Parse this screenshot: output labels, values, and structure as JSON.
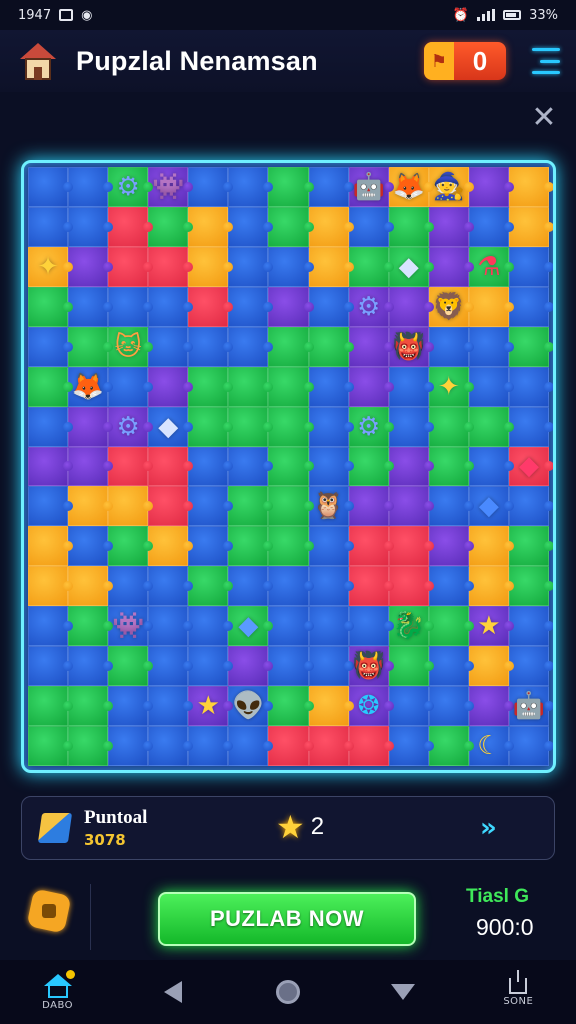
{
  "status": {
    "time": "1947",
    "battery": "33%"
  },
  "header": {
    "title": "Pupzlal Nenamsan",
    "coins": "0",
    "coin_icon": "flag-coin-icon",
    "menu_icon": "menu-icon"
  },
  "close_label": "✕",
  "board": {
    "rows": 15,
    "cols": 13,
    "colors": {
      "B": "#3a7bf0",
      "G": "#38d968",
      "P": "#8a4ee8",
      "O": "#ffc23a",
      "R": "#ff5066",
      "T": "#2cc0d0"
    },
    "grid": [
      "BBGPBBGBPOOPO",
      "BBRGOBGOBGPBO",
      "OPRROBBOGGPGB",
      "GBBBRBPBPPOOB",
      "BGGBBBGGPPBBG",
      "GBBPGGGBPBGBB",
      "BPPBGGGBGBGGB",
      "PPRRBBGBGPGBR",
      "BOORBGGBPPBBB",
      "OBGOBGGBRRPOG",
      "OOBBGBBBRRBOG",
      "BGBBBGBBBGGPB",
      "BBGBBPBBPGBOB",
      "GGBBPBGOPBBPB",
      "GGBBBBRRRBGBB"
    ],
    "pieces": [
      {
        "name": "gear-piece-icon",
        "glyph": "⚙",
        "row": 0,
        "col": 2,
        "color": "#7aa0ff"
      },
      {
        "name": "green-creature-icon",
        "glyph": "👾",
        "row": 0,
        "col": 3,
        "color": "#5df070"
      },
      {
        "name": "robot-creature-icon",
        "glyph": "🤖",
        "row": 0,
        "col": 8,
        "color": "#4fb0ff"
      },
      {
        "name": "fox-creature-icon",
        "glyph": "🦊",
        "row": 0,
        "col": 9,
        "color": "#ff9a3a"
      },
      {
        "name": "wizard-creature-icon",
        "glyph": "🧙",
        "row": 0,
        "col": 10,
        "color": "#b070ff"
      },
      {
        "name": "gold-star-icon",
        "glyph": "✦",
        "row": 2,
        "col": 0,
        "color": "#ffd23a"
      },
      {
        "name": "crystal-piece-icon",
        "glyph": "◆",
        "row": 2,
        "col": 9,
        "color": "#d8e4ff"
      },
      {
        "name": "potion-piece-icon",
        "glyph": "⚗",
        "row": 2,
        "col": 11,
        "color": "#ff3a5a"
      },
      {
        "name": "blue-gear-icon",
        "glyph": "⚙",
        "row": 3,
        "col": 8,
        "color": "#7aa0ff"
      },
      {
        "name": "lion-creature-icon",
        "glyph": "🦁",
        "row": 3,
        "col": 10,
        "color": "#ffb05a"
      },
      {
        "name": "cat-creature-icon",
        "glyph": "🐱",
        "row": 4,
        "col": 2,
        "color": "#ffa040"
      },
      {
        "name": "pink-monster-icon",
        "glyph": "👹",
        "row": 4,
        "col": 9,
        "color": "#ff4a9a"
      },
      {
        "name": "fox-kit-icon",
        "glyph": "🦊",
        "row": 5,
        "col": 1,
        "color": "#ff9a3a"
      },
      {
        "name": "gold-star-icon",
        "glyph": "✦",
        "row": 5,
        "col": 10,
        "color": "#ffd23a"
      },
      {
        "name": "blue-gear-icon",
        "glyph": "⚙",
        "row": 6,
        "col": 2,
        "color": "#7aa0ff"
      },
      {
        "name": "crystal-piece-icon",
        "glyph": "◆",
        "row": 6,
        "col": 3,
        "color": "#d8e4ff"
      },
      {
        "name": "blue-gear-icon",
        "glyph": "⚙",
        "row": 6,
        "col": 8,
        "color": "#7aa0ff"
      },
      {
        "name": "ruby-gem-icon",
        "glyph": "◆",
        "row": 7,
        "col": 12,
        "color": "#ff3a6a"
      },
      {
        "name": "owl-creature-icon",
        "glyph": "🦉",
        "row": 8,
        "col": 7,
        "color": "#ff9a3a"
      },
      {
        "name": "blue-fish-icon",
        "glyph": "◆",
        "row": 8,
        "col": 11,
        "color": "#4a8aff"
      },
      {
        "name": "green-creature-icon",
        "glyph": "👾",
        "row": 11,
        "col": 2,
        "color": "#5df070"
      },
      {
        "name": "blue-shard-icon",
        "glyph": "◆",
        "row": 11,
        "col": 5,
        "color": "#5a9aff"
      },
      {
        "name": "green-dragon-icon",
        "glyph": "🐉",
        "row": 11,
        "col": 9,
        "color": "#5df070"
      },
      {
        "name": "gold-star-icon",
        "glyph": "★",
        "row": 11,
        "col": 11,
        "color": "#ffd23a"
      },
      {
        "name": "pink-monster-icon",
        "glyph": "👹",
        "row": 12,
        "col": 8,
        "color": "#ff4a9a"
      },
      {
        "name": "gold-star-icon",
        "glyph": "★",
        "row": 13,
        "col": 4,
        "color": "#ffd23a"
      },
      {
        "name": "goblin-creature-icon",
        "glyph": "👽",
        "row": 13,
        "col": 5,
        "color": "#5df070"
      },
      {
        "name": "blue-flame-icon",
        "glyph": "❂",
        "row": 13,
        "col": 8,
        "color": "#29c8ff"
      },
      {
        "name": "moon-star-icon",
        "glyph": "☾",
        "row": 14,
        "col": 11,
        "color": "#ffd23a"
      },
      {
        "name": "robot-creature-icon",
        "glyph": "🤖",
        "row": 13,
        "col": 12,
        "color": "#4fb0ff"
      }
    ]
  },
  "progress": {
    "name": "Puntoal",
    "subtitle": "3078",
    "stars": "2",
    "gem_icon": "gem-icon",
    "star_icon": "star-icon",
    "forward_icon": "fast-forward-icon"
  },
  "bottom": {
    "play_label": "PUZLAB NOW",
    "timer_label": "Tiasl G",
    "timer_value": "900:0"
  },
  "nav": {
    "home_label": "DABO",
    "share_label": "SONE"
  }
}
